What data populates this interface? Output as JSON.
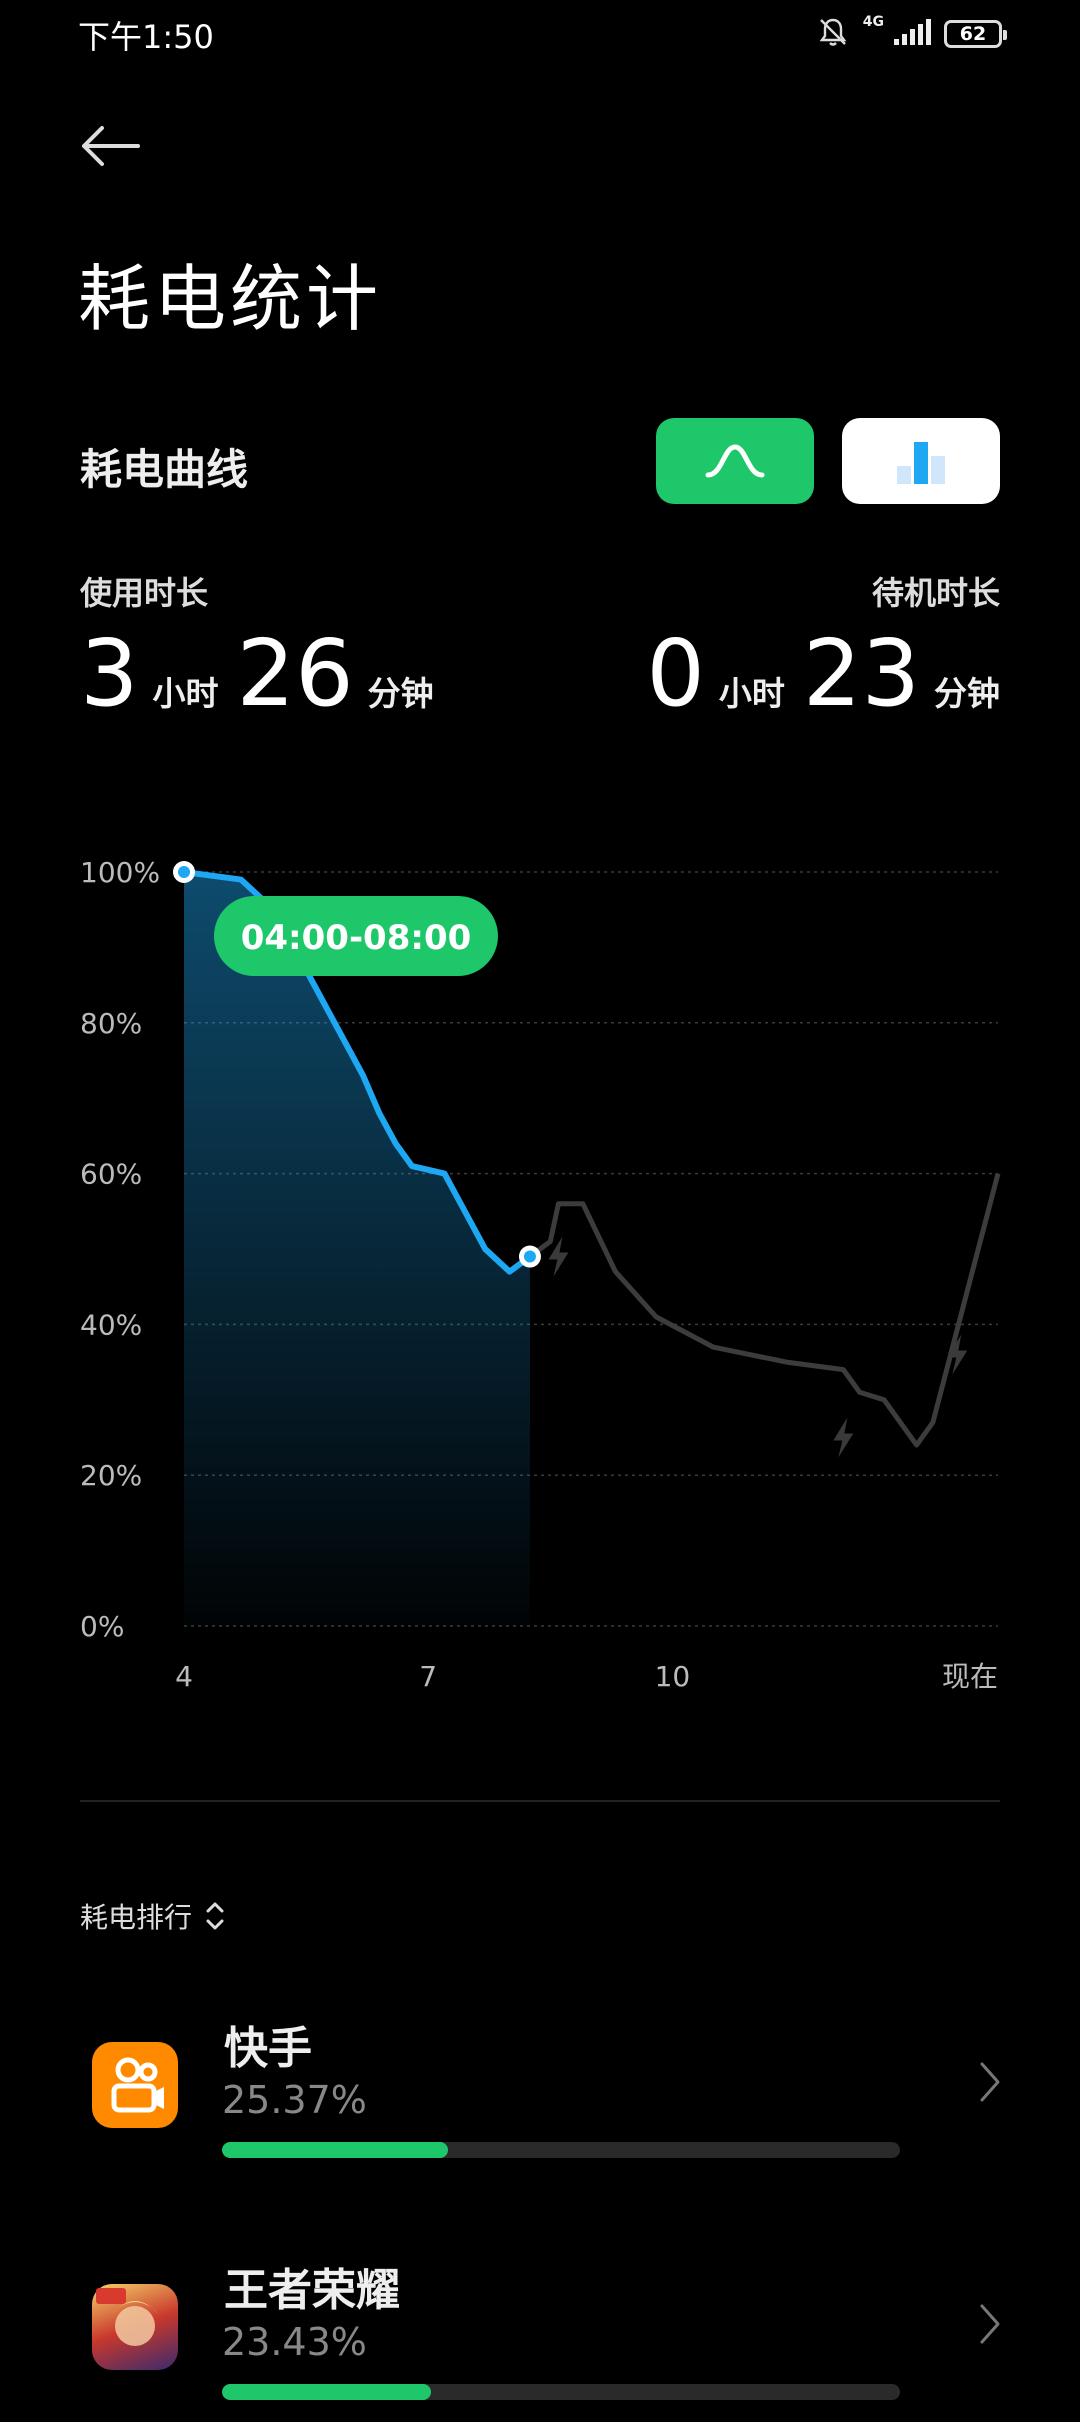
{
  "status": {
    "time": "下午1:50",
    "network": "4G",
    "battery": "62"
  },
  "header": {
    "title": "耗电统计"
  },
  "curve_section": {
    "title": "耗电曲线"
  },
  "stats": {
    "usage_label": "使用时长",
    "usage_hours": "3",
    "usage_minutes": "26",
    "standby_label": "待机时长",
    "standby_hours": "0",
    "standby_minutes": "23",
    "hour_unit": "小时",
    "minute_unit": "分钟"
  },
  "chart_data": {
    "type": "line",
    "y_ticks": [
      "100%",
      "80%",
      "60%",
      "40%",
      "20%",
      "0%"
    ],
    "x_ticks": [
      "4",
      "7",
      "10",
      "现在"
    ],
    "ylim": [
      0,
      100
    ],
    "xlim": [
      4,
      14
    ],
    "selected_range_label": "04:00-08:00",
    "highlight_color": "#1ea7f2",
    "series": [
      {
        "x": [
          4.0,
          4.7,
          5.0,
          5.3,
          5.6,
          5.9,
          6.2,
          6.4,
          6.6,
          6.8,
          7.2,
          7.4,
          7.7,
          8.0,
          8.25
        ],
        "y": [
          100,
          99,
          96,
          91,
          85,
          79,
          73,
          68,
          64,
          61,
          60,
          56,
          50,
          47,
          49
        ]
      },
      {
        "x": [
          8.25,
          8.5,
          8.6,
          8.9,
          9.3,
          9.8,
          10.5,
          11.4,
          12.1,
          12.3,
          12.6,
          13.0,
          13.2,
          14.0
        ],
        "y": [
          49,
          51,
          56,
          56,
          47,
          41,
          37,
          35,
          34,
          31,
          30,
          24,
          27,
          60
        ]
      }
    ],
    "charging_marks": [
      {
        "x": 8.6,
        "y": 49
      },
      {
        "x": 12.1,
        "y": 25
      },
      {
        "x": 13.5,
        "y": 36
      }
    ]
  },
  "ranking": {
    "title": "耗电排行",
    "apps": [
      {
        "name": "快手",
        "percent_text": "25.37%",
        "share": 0.2537
      },
      {
        "name": "王者荣耀",
        "percent_text": "23.43%",
        "share": 0.2343
      }
    ]
  },
  "colors": {
    "accent_green": "#1ec86a",
    "accent_blue": "#1ea7f2",
    "kuaishou_orange": "#ff8a00"
  }
}
